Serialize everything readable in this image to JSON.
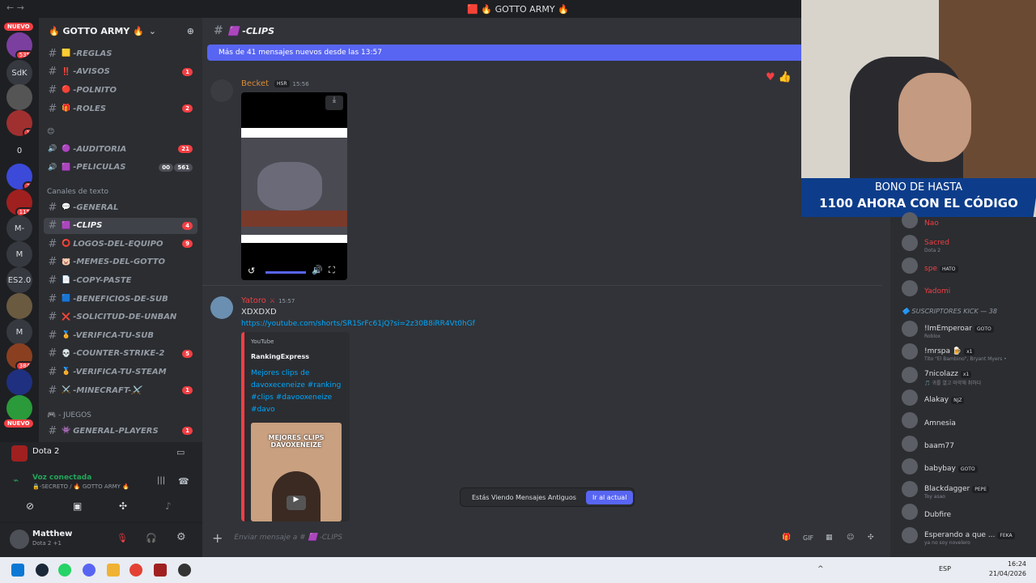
{
  "window": {
    "title": "🟥 🔥 GOTTO ARMY 🔥",
    "nav": "← →"
  },
  "servers": {
    "nuevo_label": "NUEVO",
    "items": [
      {
        "label": "",
        "badge": "535",
        "color": "#7b3fa0"
      },
      {
        "label": "SdK",
        "badge": "",
        "color": "#36393f"
      },
      {
        "label": "",
        "badge": "",
        "color": "#555"
      },
      {
        "label": "",
        "badge": "1",
        "color": "#a03030"
      },
      {
        "label": "0",
        "badge": "",
        "color": "#1e1f22"
      },
      {
        "label": "",
        "badge": "2",
        "color": "#3b4ad8"
      },
      {
        "label": "",
        "badge": "115",
        "color": "#a02020"
      },
      {
        "label": "M-",
        "badge": "",
        "color": "#36393f"
      },
      {
        "label": "M",
        "badge": "",
        "color": "#36393f"
      },
      {
        "label": "ES2.0",
        "badge": "",
        "color": "#36393f"
      },
      {
        "label": "",
        "badge": "",
        "color": "#6a5a40"
      },
      {
        "label": "M",
        "badge": "",
        "color": "#36393f"
      },
      {
        "label": "",
        "badge": "384",
        "color": "#8a4020"
      },
      {
        "label": "",
        "badge": "",
        "color": "#203080"
      },
      {
        "label": "",
        "badge": "",
        "color": "#2a9a3a"
      }
    ]
  },
  "server": {
    "name": "🔥 GOTTO ARMY 🔥"
  },
  "channels": {
    "top": [
      {
        "emoji": "🟨",
        "name": "-REGLAS",
        "badge": ""
      },
      {
        "emoji": "‼️",
        "name": "-AVISOS",
        "badge": "1"
      },
      {
        "emoji": "🔴",
        "name": "-POLNITO",
        "badge": ""
      },
      {
        "emoji": "🎁",
        "name": "-ROLES",
        "badge": "2"
      }
    ],
    "cat_emoji": "😊",
    "voice": [
      {
        "emoji": "🟣",
        "name": "-AUDITORIA",
        "badge": "21",
        "extra": ""
      },
      {
        "emoji": "🟪",
        "name": "-PELICULAS",
        "badge": "561",
        "extra": "00"
      }
    ],
    "text_category": "Canales de texto",
    "text": [
      {
        "emoji": "💬",
        "name": "-GENERAL",
        "badge": ""
      },
      {
        "emoji": "🟪",
        "name": "-CLIPS",
        "badge": "4"
      },
      {
        "emoji": "⭕",
        "name": "LOGOS-DEL-EQUIPO",
        "badge": "9"
      },
      {
        "emoji": "🐷",
        "name": "-MEMES-DEL-GOTTO",
        "badge": ""
      },
      {
        "emoji": "📄",
        "name": "-COPY-PASTE",
        "badge": ""
      },
      {
        "emoji": "🟦",
        "name": "-BENEFICIOS-DE-SUB",
        "badge": ""
      },
      {
        "emoji": "❌",
        "name": "-SOLICITUD-DE-UNBAN",
        "badge": ""
      },
      {
        "emoji": "🏅",
        "name": "-VERIFICA-TU-SUB",
        "badge": ""
      },
      {
        "emoji": "💀",
        "name": "-COUNTER-STRIKE-2",
        "badge": "5"
      },
      {
        "emoji": "🏅",
        "name": "-VERIFICA-TU-STEAM",
        "badge": ""
      },
      {
        "emoji": "⚔️",
        "name": "-MINECRAFT-⚔️",
        "badge": "1"
      }
    ],
    "games_category": "🎮 - JUEGOS",
    "games": [
      {
        "emoji": "👾",
        "name": "GENERAL-PLAYERS",
        "badge": "1"
      }
    ]
  },
  "activity": {
    "game": "Dota 2"
  },
  "voice": {
    "status": "Voz conectada",
    "channel": "🔒-SECRETO / 🔥 GOTTO ARMY 🔥"
  },
  "user": {
    "name": "Matthew",
    "status": "Dota 2 +1"
  },
  "chat": {
    "channel": "🟪 -CLIPS",
    "new_messages": "Más de 41 mensajes nuevos desde las 13:57",
    "messages": [
      {
        "author": "Becket",
        "tag": "HSR",
        "time": "15:56",
        "text": ""
      },
      {
        "author": "Yatoro",
        "tag": "",
        "time": "15:57",
        "text": "XDXDXD",
        "link": "https://youtube.com/shorts/SR1SrFc61jQ?si=2z30B8iRR4Vt0hGf",
        "embed": {
          "provider": "YouTube",
          "author": "RankingExpress",
          "title": "Mejores clips de davoxeceneize #ranking #clips #davooxeneize #davo",
          "thumb_text": "MEJORES CLIPS DAVOXENEIZE"
        }
      }
    ],
    "old_notice": "Estás Viendo Mensajes Antiguos",
    "jump_btn": "Ir al actual",
    "input_placeholder": "Enviar mensaje a # 🟪 -CLIPS"
  },
  "overlay": {
    "line1": "BONO DE HASTA",
    "line2": "1100 AHORA CON EL CÓDIGO"
  },
  "members": {
    "section": "🔷 SUSCRIPTORES KICK — 38",
    "list_top": [
      {
        "name": "Nao",
        "sub": "",
        "color": "#f23f43",
        "tag": ""
      },
      {
        "name": "Sacred",
        "sub": "Dota 2",
        "color": "#f23f43",
        "tag": ""
      },
      {
        "name": "spe",
        "sub": "",
        "color": "#f23f43",
        "tag": "HATO"
      },
      {
        "name": "Yadomi",
        "sub": "",
        "color": "#f23f43",
        "tag": ""
      }
    ],
    "list": [
      {
        "name": "!ImEmperoar",
        "sub": "Roblox",
        "color": "#dbdee1",
        "tag": "GOTO"
      },
      {
        "name": "!mrspa 🍺",
        "sub": "Tito \"El Bambino\", Bryant Myers •",
        "color": "#dbdee1",
        "tag": "x1"
      },
      {
        "name": "7nicolazz",
        "sub": "🎵 귀를 열고 마약해 취하다",
        "color": "#dbdee1",
        "tag": "x1"
      },
      {
        "name": "Alakay",
        "sub": "",
        "color": "#dbdee1",
        "tag": "NJZ"
      },
      {
        "name": "Amnesia",
        "sub": "",
        "color": "#dbdee1",
        "tag": ""
      },
      {
        "name": "baam77",
        "sub": "",
        "color": "#dbdee1",
        "tag": ""
      },
      {
        "name": "babybay",
        "sub": "",
        "color": "#dbdee1",
        "tag": "GOTO"
      },
      {
        "name": "Blackdagger",
        "sub": "Toy asao",
        "color": "#dbdee1",
        "tag": "PEPE"
      },
      {
        "name": "Dubfire",
        "sub": "",
        "color": "#dbdee1",
        "tag": ""
      },
      {
        "name": "Esperando a que ...",
        "sub": "ya no soy novelero",
        "color": "#dbdee1",
        "tag": "FEKA"
      }
    ]
  },
  "taskbar": {
    "lang": "ESP",
    "time": "16:24",
    "date": "21/04/2026"
  }
}
